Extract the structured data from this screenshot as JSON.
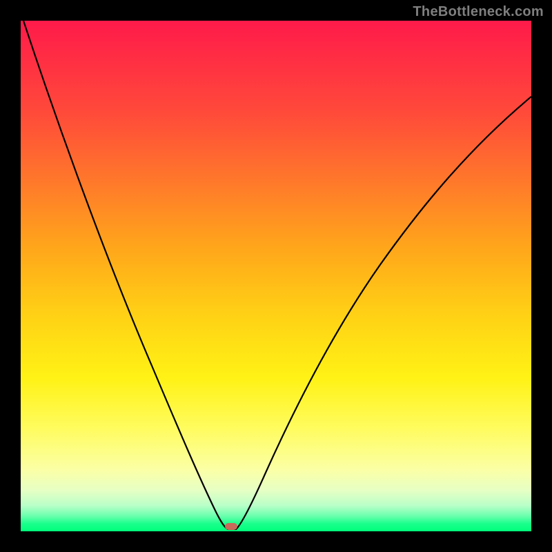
{
  "watermark": "TheBottleneck.com",
  "chart_data": {
    "type": "line",
    "title": "",
    "xlabel": "",
    "ylabel": "",
    "xlim": [
      0,
      100
    ],
    "ylim": [
      0,
      100
    ],
    "grid": false,
    "legend": false,
    "description": "V-shaped bottleneck curve over red-to-green vertical gradient. Minimum near x≈40 at y≈0.",
    "series": [
      {
        "name": "bottleneck-curve",
        "x": [
          0,
          5,
          10,
          15,
          20,
          25,
          30,
          35,
          38,
          40,
          42,
          45,
          50,
          55,
          60,
          65,
          70,
          75,
          80,
          85,
          90,
          95,
          100
        ],
        "y": [
          100,
          87,
          74,
          62,
          50,
          38,
          27,
          15,
          6,
          0,
          5,
          15,
          29,
          41,
          51,
          59,
          66,
          72,
          77,
          81,
          85,
          88,
          90
        ]
      }
    ],
    "marker": {
      "x": 40,
      "y": 0,
      "color": "#c96a5a"
    },
    "gradient_stops": [
      {
        "pos": 0,
        "color": "#ff1a4a"
      },
      {
        "pos": 50,
        "color": "#ffd215"
      },
      {
        "pos": 100,
        "color": "#00ff7a"
      }
    ]
  }
}
